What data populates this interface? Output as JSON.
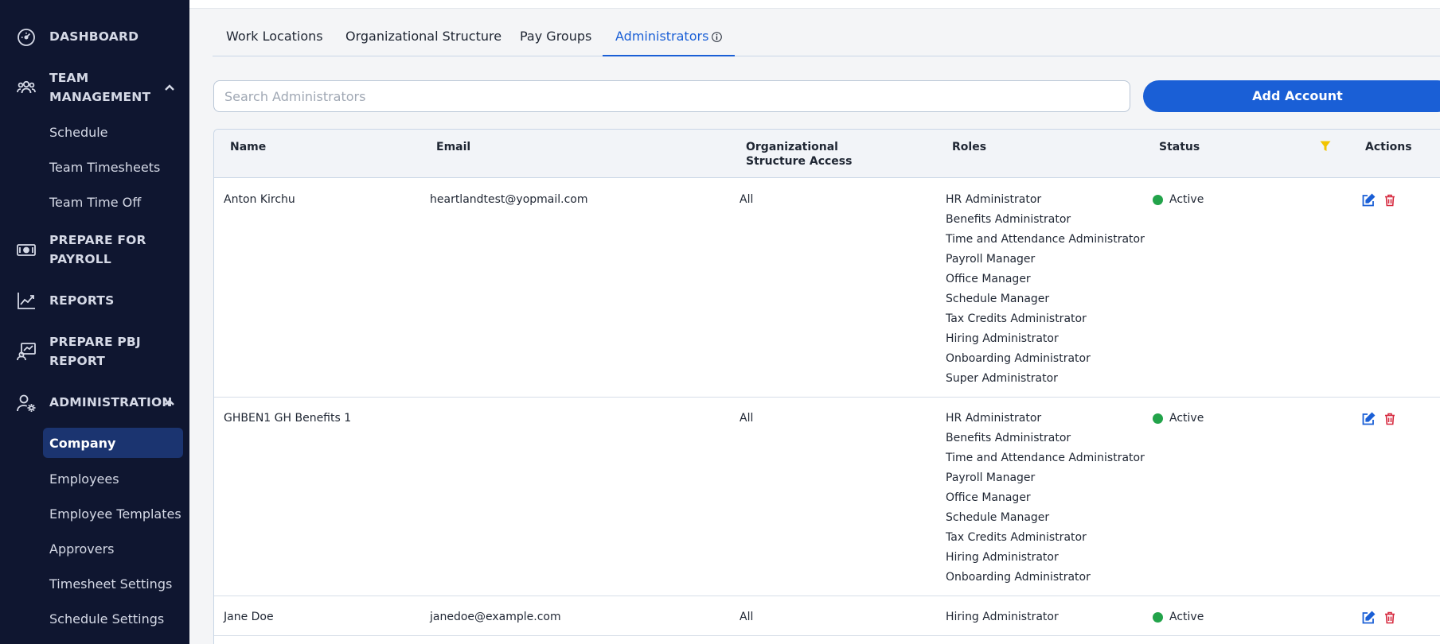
{
  "sidebar": {
    "main": [
      {
        "label": "DASHBOARD",
        "icon": "dashboard-gauge-icon"
      },
      {
        "label": "TEAM MANAGEMENT",
        "icon": "team-icon",
        "expanded": true
      },
      {
        "label": "PREPARE FOR PAYROLL",
        "icon": "money-icon"
      },
      {
        "label": "REPORTS",
        "icon": "chart-icon"
      },
      {
        "label": "PREPARE PBJ REPORT",
        "icon": "pbj-report-icon"
      },
      {
        "label": "ADMINISTRATION",
        "icon": "admin-user-gear-icon",
        "expanded": true
      }
    ],
    "team_sub": [
      "Schedule",
      "Team Timesheets",
      "Team Time Off"
    ],
    "admin_sub": [
      "Company",
      "Employees",
      "Employee Templates",
      "Approvers",
      "Timesheet Settings",
      "Schedule Settings"
    ],
    "active_item": "Company"
  },
  "tabs": [
    {
      "label": "Work Locations"
    },
    {
      "label": "Organizational Structure"
    },
    {
      "label": "Pay Groups"
    },
    {
      "label": "Administrators",
      "active": true
    }
  ],
  "search": {
    "placeholder": "Search Administrators",
    "value": ""
  },
  "add_button": {
    "label": "Add Account"
  },
  "table": {
    "headers": {
      "name": "Name",
      "email": "Email",
      "org_line1": "Organizational",
      "org_line2": "Structure Access",
      "roles": "Roles",
      "status": "Status",
      "actions": "Actions"
    },
    "rows": [
      {
        "name": "Anton Kirchu",
        "email": "heartlandtest@yopmail.com",
        "org_access": "All",
        "roles": [
          "HR Administrator",
          "Benefits Administrator",
          "Time and Attendance Administrator",
          "Payroll Manager",
          "Office Manager",
          "Schedule Manager",
          "Tax Credits Administrator",
          "Hiring Administrator",
          "Onboarding Administrator",
          "Super Administrator"
        ],
        "status": "Active"
      },
      {
        "name": "GHBEN1 GH Benefits 1",
        "email": "",
        "org_access": "All",
        "roles": [
          "HR Administrator",
          "Benefits Administrator",
          "Time and Attendance Administrator",
          "Payroll Manager",
          "Office Manager",
          "Schedule Manager",
          "Tax Credits Administrator",
          "Hiring Administrator",
          "Onboarding Administrator"
        ],
        "status": "Active"
      },
      {
        "name": "Jane Doe",
        "email": "janedoe@example.com",
        "org_access": "All",
        "roles": [
          "Hiring Administrator"
        ],
        "status": "Active"
      }
    ]
  },
  "colors": {
    "sidebar_bg": "#0f1630",
    "accent": "#1a5fd6",
    "active_nav_bg": "#1b3470",
    "status_active": "#22a34a",
    "filter_icon": "#f2c400",
    "delete_icon": "#d6293e"
  }
}
